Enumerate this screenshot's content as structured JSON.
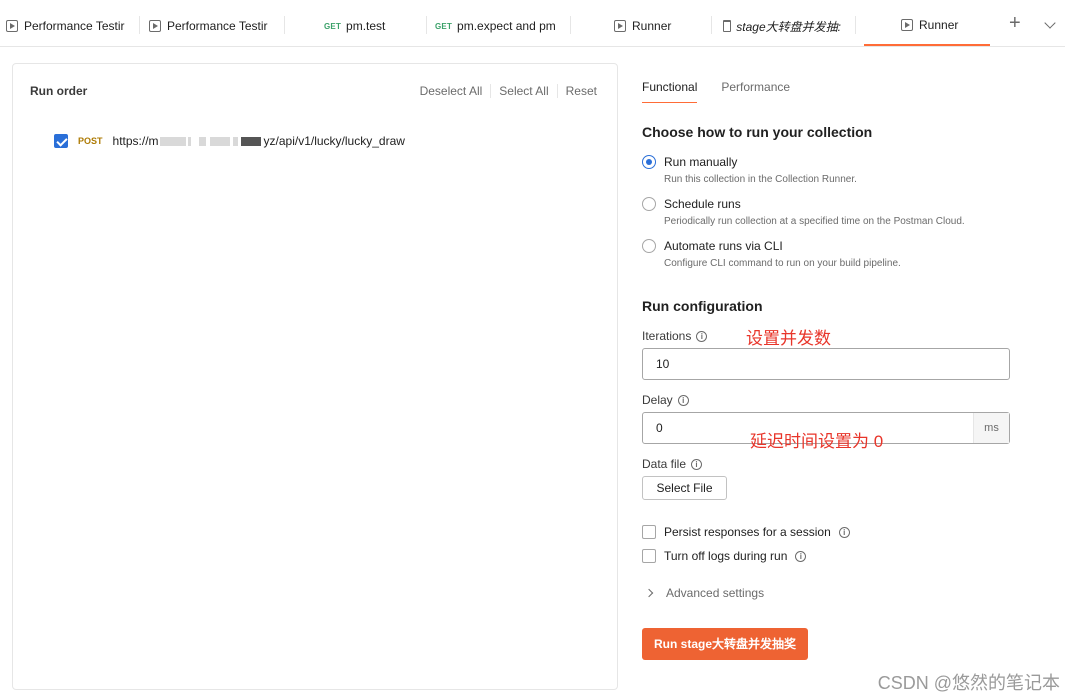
{
  "tabs": [
    {
      "type": "runner",
      "label": "Performance Testir"
    },
    {
      "type": "runner",
      "label": "Performance Testir"
    },
    {
      "type": "request",
      "method": "GET",
      "label": "pm.test"
    },
    {
      "type": "request",
      "method": "GET",
      "label": "pm.expect and pm"
    },
    {
      "type": "runner",
      "label": "Runner"
    },
    {
      "type": "collection",
      "label": "stage大转盘并发抽:"
    },
    {
      "type": "runner",
      "label": "Runner",
      "active": true
    }
  ],
  "tab_actions": {
    "new_tab": "+"
  },
  "left": {
    "title": "Run order",
    "actions": {
      "deselect_all": "Deselect All",
      "select_all": "Select All",
      "reset": "Reset"
    },
    "requests": [
      {
        "checked": true,
        "method": "POST",
        "url_prefix": "https://m",
        "url_suffix": "yz/api/v1/lucky/lucky_draw"
      }
    ]
  },
  "right": {
    "tabs": [
      "Functional",
      "Performance"
    ],
    "active_tab": "Functional",
    "section_run": "Choose how to run your collection",
    "options": [
      {
        "label": "Run manually",
        "desc": "Run this collection in the Collection Runner.",
        "selected": true
      },
      {
        "label": "Schedule runs",
        "desc": "Periodically run collection at a specified time on the Postman Cloud.",
        "selected": false
      },
      {
        "label": "Automate runs via CLI",
        "desc": "Configure CLI command to run on your build pipeline.",
        "selected": false
      }
    ],
    "section_config": "Run configuration",
    "iterations": {
      "label": "Iterations",
      "value": "10"
    },
    "delay": {
      "label": "Delay",
      "value": "0",
      "unit": "ms"
    },
    "data_file": {
      "label": "Data file",
      "button": "Select File"
    },
    "persist": {
      "label": "Persist responses for a session",
      "checked": false
    },
    "turn_off_logs": {
      "label": "Turn off logs during run",
      "checked": false
    },
    "advanced": "Advanced settings",
    "run_button": "Run stage大转盘并发抽奖"
  },
  "annotations": {
    "iterations_note": "设置并发数",
    "delay_note": "延迟时间设置为 0"
  },
  "watermark": "CSDN @悠然的笔记本",
  "colors": {
    "accent": "#ff6c37",
    "run_button": "#ee6333",
    "checkbox": "#2a6fd8",
    "post_method": "#ad7a03",
    "annotation": "#e8352a"
  }
}
